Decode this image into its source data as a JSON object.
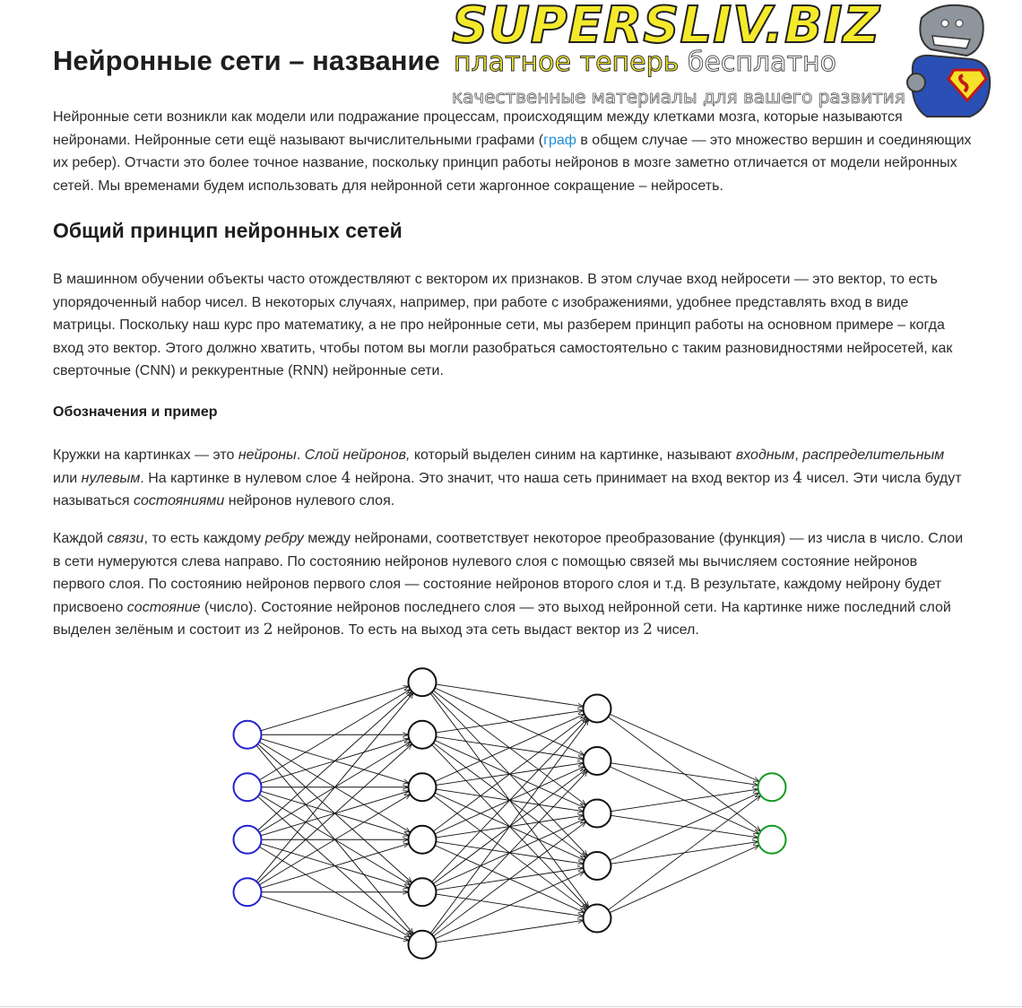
{
  "page_title": "Нейронные сети – название",
  "intro": {
    "before_link": "Нейронные сети возникли как модели или подражание процессам, происходящим между клетками мозга, которые называются нейронами. Нейронные сети ещё называют вычислительными графами (",
    "link_text": "граф",
    "after_link": " в общем случае — это множество вершин и соединяющих их ребер). Отчасти это более точное название, поскольку принцип работы нейронов в мозге заметно отличается от модели нейронных сетей. Мы временами будем использовать для нейронной сети жаргонное сокращение – нейросеть."
  },
  "section_heading": "Общий принцип нейронных сетей",
  "section_paragraph": "В машинном обучении объекты часто отождествляют с вектором их признаков. В этом случае вход нейросети — это вектор, то есть упорядоченный набор чисел. В некоторых случаях, например, при работе с изображениями, удобнее представлять вход в виде матрицы. Поскольку наш курс про математику, а не про нейронные сети, мы разберем принцип работы на основном примере – когда вход это вектор. Этого должно хватить, чтобы потом вы могли разобраться самостоятельно с таким разновидностями нейросетей, как сверточные (CNN) и реккурентные (RNN) нейронные сети.",
  "subheading": "Обозначения и пример",
  "para3": {
    "t1": "Кружки на картинках — это ",
    "i1": "нейроны",
    "t2": ". ",
    "i2": "Слой нейронов,",
    "t3": " который выделен синим на картинке, называют ",
    "i3": "входным",
    "t4": ", ",
    "i4": "распределительным",
    "t5": " или ",
    "i5": "нулевым",
    "t6": ". На картинке в нулевом слое ",
    "m1": "4",
    "t7": " нейрона. Это значит, что наша сеть принимает на вход вектор из ",
    "m2": "4",
    "t8": " чисел. Эти числа будут называться ",
    "i6": "состояниями",
    "t9": " нейронов нулевого слоя."
  },
  "para4": {
    "t1": "Каждой ",
    "i1": "связи",
    "t2": ", то есть каждому ",
    "i2": "ребру",
    "t3": " между нейронами, соответствует некоторое преобразование (функция) — из числа в число. Слои в сети нумеруются слева направо. По состоянию нейронов нулевого слоя с помощью связей мы вычисляем состояние нейронов первого слоя. По состоянию нейронов первого слоя — состояние нейронов второго слоя и т.д. В результате, каждому нейрону будет присвоено ",
    "i3": "состояние",
    "t4": " (число). Состояние нейронов последнего слоя — это выход нейронной сети. На картинке ниже последний слой выделен зелёным и состоит из ",
    "m1": "2",
    "t5": " нейронов. То есть на выход эта сеть выдаст вектор из ",
    "m2": "2",
    "t6": " чисел."
  },
  "network": {
    "layer_sizes": [
      4,
      6,
      5,
      2
    ],
    "colors": {
      "input": "#2222cc",
      "hidden": "#111111",
      "output": "#119922",
      "edge": "#111111"
    }
  },
  "watermark": {
    "title": "SUPERSLIV.BIZ",
    "line1_a": "платное теперь ",
    "line1_b": "бесплатно",
    "line2": "качественные материалы для вашего развития"
  }
}
